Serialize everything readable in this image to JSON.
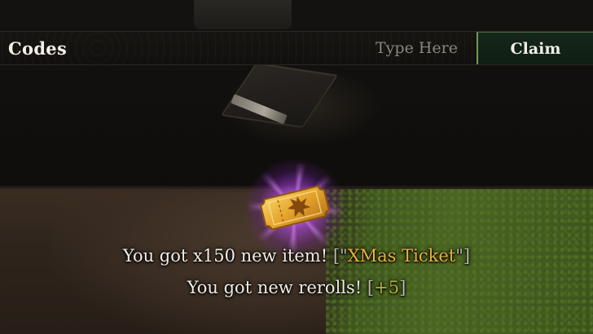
{
  "codes": {
    "title": "Codes",
    "input_placeholder": "Type Here",
    "input_value": "",
    "claim_label": "Claim"
  },
  "reward": {
    "item_icon": "golden-ticket-icon",
    "line1": {
      "prefix": "You got x150 new item! ",
      "open": "[\"",
      "item_name": "XMas Ticket",
      "close": "\"]"
    },
    "line2": {
      "prefix": "You got new rerolls! ",
      "open": "[",
      "amount": "+5",
      "close": "]"
    }
  },
  "colors": {
    "item_highlight": "#e9b23b",
    "reroll_highlight": "#b5b33a",
    "claim_border": "#6f9a57",
    "glow": "#b046e6"
  }
}
